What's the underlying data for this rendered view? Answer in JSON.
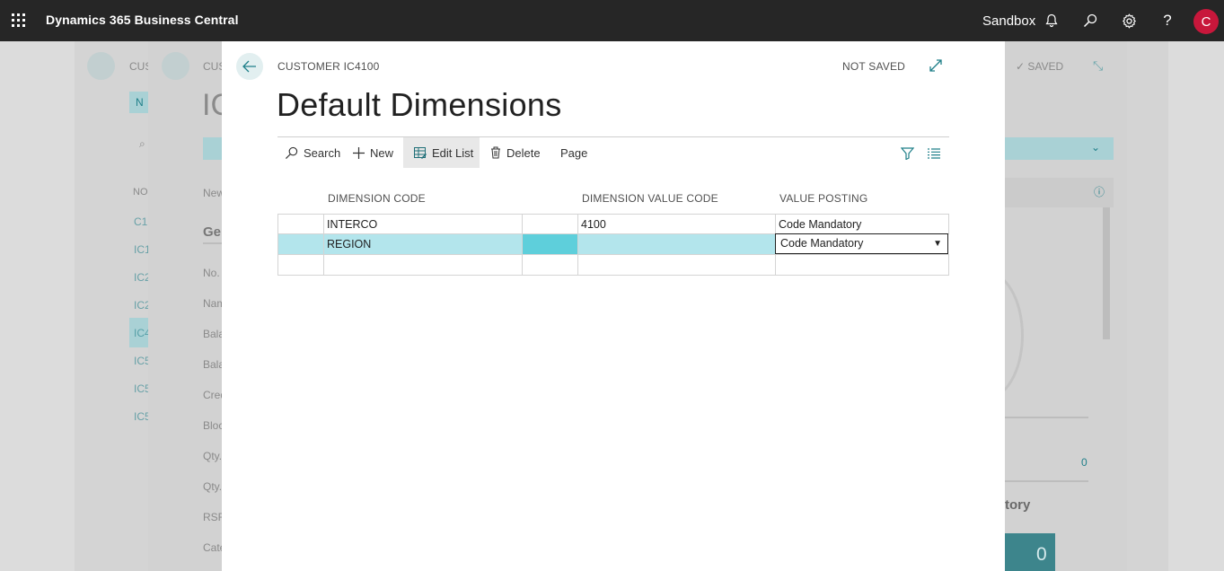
{
  "app": {
    "product": "Dynamics 365 Business Central",
    "environment": "Sandbox",
    "user_initial": "C",
    "icons": [
      "waffle-icon",
      "bell-icon",
      "search-icon",
      "gear-icon",
      "help-icon"
    ]
  },
  "background": {
    "page1": {
      "caption": "CUS",
      "nav_items": [
        "NO",
        "C1",
        "IC1",
        "IC2",
        "IC2",
        "IC4",
        "IC5",
        "IC5",
        "IC5"
      ],
      "btn": "N"
    },
    "page2": {
      "caption": "CUS",
      "title": "IC",
      "status": "SAVED",
      "new_label": "New",
      "section": "Ge",
      "fields": [
        "No.",
        "Nam",
        "Bala",
        "Bala",
        "Cred",
        "Bloc",
        "Qty.",
        "Qty.",
        "RSF",
        "Cate"
      ],
      "count_value": "0",
      "tile_title": "tory",
      "tile_value": "0"
    }
  },
  "dialog": {
    "caption": "CUSTOMER IC4100",
    "status": "NOT SAVED",
    "title": "Default Dimensions",
    "actions": {
      "search": "Search",
      "new": "New",
      "edit_list": "Edit List",
      "delete": "Delete",
      "page": "Page"
    },
    "columns": {
      "dimension_code": "DIMENSION CODE",
      "dimension_value_code": "DIMENSION VALUE CODE",
      "value_posting": "VALUE POSTING"
    },
    "rows": [
      {
        "dimension_code": "INTERCO",
        "dimension_value_code": "4100",
        "value_posting": "Code Mandatory"
      },
      {
        "dimension_code": "REGION",
        "dimension_value_code": "",
        "value_posting": "Code Mandatory"
      },
      {
        "dimension_code": "",
        "dimension_value_code": "",
        "value_posting": ""
      }
    ],
    "selected_row": 1,
    "colors": {
      "selected_row": "#b3e5ec",
      "focused_cell": "#5ecfdb",
      "accent": "#008489"
    }
  }
}
